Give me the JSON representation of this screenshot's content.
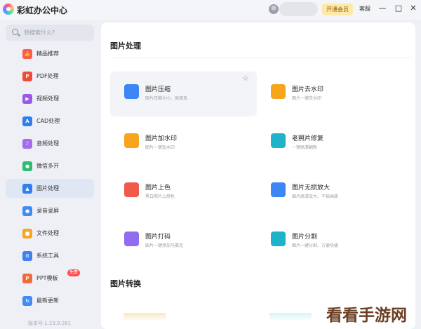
{
  "app": {
    "title": "彩虹办公中心"
  },
  "header": {
    "vip_label": "开通会员",
    "service_label": "客服",
    "minimize": "—",
    "maximize": "□",
    "close": "✕"
  },
  "search": {
    "placeholder": "想搜索什么?"
  },
  "sidebar": {
    "items": [
      {
        "label": "精品推荐",
        "icon": "thumbs-up-icon",
        "color": "#ff5a4e",
        "glyph": "👍"
      },
      {
        "label": "PDF处理",
        "icon": "pdf-icon",
        "color": "#ef4c36",
        "glyph": "P"
      },
      {
        "label": "视频处理",
        "icon": "video-icon",
        "color": "#9b59e8",
        "glyph": "▶"
      },
      {
        "label": "CAD处理",
        "icon": "cad-icon",
        "color": "#2f80ed",
        "glyph": "A"
      },
      {
        "label": "音频处理",
        "icon": "music-icon",
        "color": "#a66cf0",
        "glyph": "♪"
      },
      {
        "label": "微信多开",
        "icon": "wechat-icon",
        "color": "#2dbd6e",
        "glyph": "●"
      },
      {
        "label": "图片处理",
        "icon": "image-icon",
        "color": "#2f7fee",
        "glyph": "▲",
        "active": true
      },
      {
        "label": "录音录屏",
        "icon": "microphone-icon",
        "color": "#3f8cf5",
        "glyph": "●"
      },
      {
        "label": "文件处理",
        "icon": "folder-icon",
        "color": "#f5a623",
        "glyph": "■"
      },
      {
        "label": "系统工具",
        "icon": "gear-icon",
        "color": "#3f7ff0",
        "glyph": "⚙"
      },
      {
        "label": "PPT模板",
        "icon": "ppt-icon",
        "color": "#f26b3a",
        "glyph": "P",
        "badge": "免费"
      },
      {
        "label": "最新更新",
        "icon": "update-icon",
        "color": "#3f8cf5",
        "glyph": "↻"
      }
    ],
    "version": "版本号:1.23.9.261"
  },
  "main": {
    "section_title": "图片处理",
    "cards": [
      {
        "title": "图片压缩",
        "desc": "图片压缩大小、高保真",
        "icon": "compress-icon",
        "color": "#3c86f5"
      },
      {
        "title": "图片去水印",
        "desc": "图片一键去水印",
        "icon": "remove-watermark-icon",
        "color": "#f7a51c"
      },
      {
        "title": "图片加水印",
        "desc": "图片一键加水印",
        "icon": "add-watermark-icon",
        "color": "#f7a51c"
      },
      {
        "title": "老照片修复",
        "desc": "一键高清翻新",
        "icon": "photo-restore-icon",
        "color": "#1fb3c9"
      },
      {
        "title": "图片上色",
        "desc": "黑白照片上颜色",
        "icon": "colorize-icon",
        "color": "#f05a4a"
      },
      {
        "title": "图片无损放大",
        "desc": "图片高清放大、不损画质",
        "icon": "upscale-icon",
        "color": "#3c86f5"
      },
      {
        "title": "图片打码",
        "desc": "图片一键添加马赛克",
        "icon": "mosaic-icon",
        "color": "#8f6cf0"
      },
      {
        "title": "图片分割",
        "desc": "图片一键分割、方便快捷",
        "icon": "split-icon",
        "color": "#1fb3c9"
      }
    ],
    "section2_title": "图片转换"
  },
  "watermark": {
    "text": "看看手游网"
  }
}
